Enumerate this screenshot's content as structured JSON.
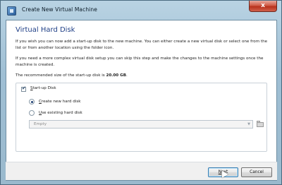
{
  "window": {
    "title": "Create New Virtual Machine",
    "close_glyph": "x"
  },
  "page": {
    "title": "Virtual Hard Disk",
    "paragraphs": [
      "If you wish you can now add a start-up disk to the new machine. You can either create a new virtual disk or select one from the list or from another location using the folder icon.",
      "If you need a more complex virtual disk setup you can skip this step and make the changes to the machine settings once the machine is created."
    ],
    "recommended_prefix": "The recommended size of the start-up disk is ",
    "recommended_size": "20.00 GB",
    "recommended_suffix": "."
  },
  "startup_disk": {
    "checkbox_label": "Start-up Disk",
    "checked": true,
    "options": [
      {
        "label": "Create new hard disk",
        "selected": true
      },
      {
        "label": "Use existing hard disk",
        "selected": false
      }
    ],
    "combo_value": "Empty",
    "folder_icon": "folder-icon"
  },
  "footer": {
    "next_label": "Next",
    "cancel_label": "Cancel"
  }
}
